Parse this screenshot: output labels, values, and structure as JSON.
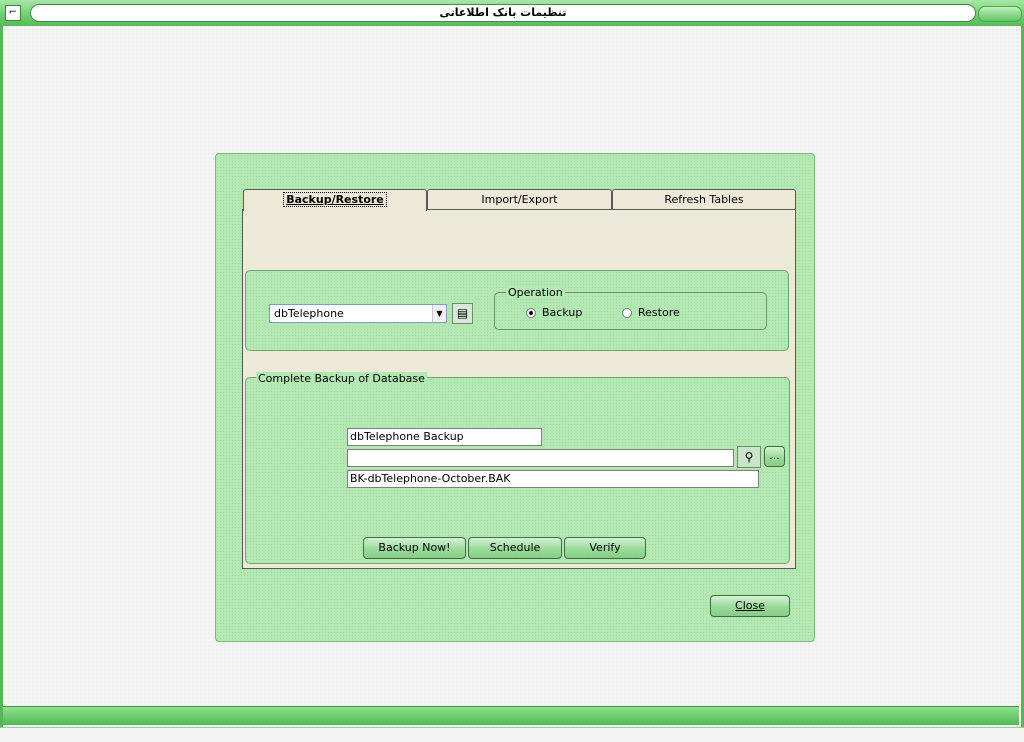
{
  "window": {
    "title": "تنظیمات بانک اطلاعاتی",
    "system_icon": "app-menu-icon"
  },
  "tabs": [
    {
      "label": "Backup/Restore",
      "active": true
    },
    {
      "label": "Import/Export",
      "active": false
    },
    {
      "label": "Refresh Tables",
      "active": false
    }
  ],
  "database_select": {
    "value": "dbTelephone"
  },
  "operation": {
    "legend": "Operation",
    "options": [
      {
        "label": "Backup",
        "selected": true
      },
      {
        "label": "Restore",
        "selected": false
      }
    ]
  },
  "backup_group": {
    "legend": "Complete Backup of Database",
    "name_value": "dbTelephone Backup",
    "path_value": "",
    "file_value": "BK-dbTelephone-October.BAK",
    "browse_label": "..."
  },
  "buttons": {
    "backup_now": "Backup Now!",
    "schedule": "Schedule",
    "verify": "Verify",
    "close": "Close"
  },
  "colors": {
    "frame_green": "#58b558",
    "dialog_bg": "#b3e8b3",
    "tab_bg": "#ece9d8"
  }
}
